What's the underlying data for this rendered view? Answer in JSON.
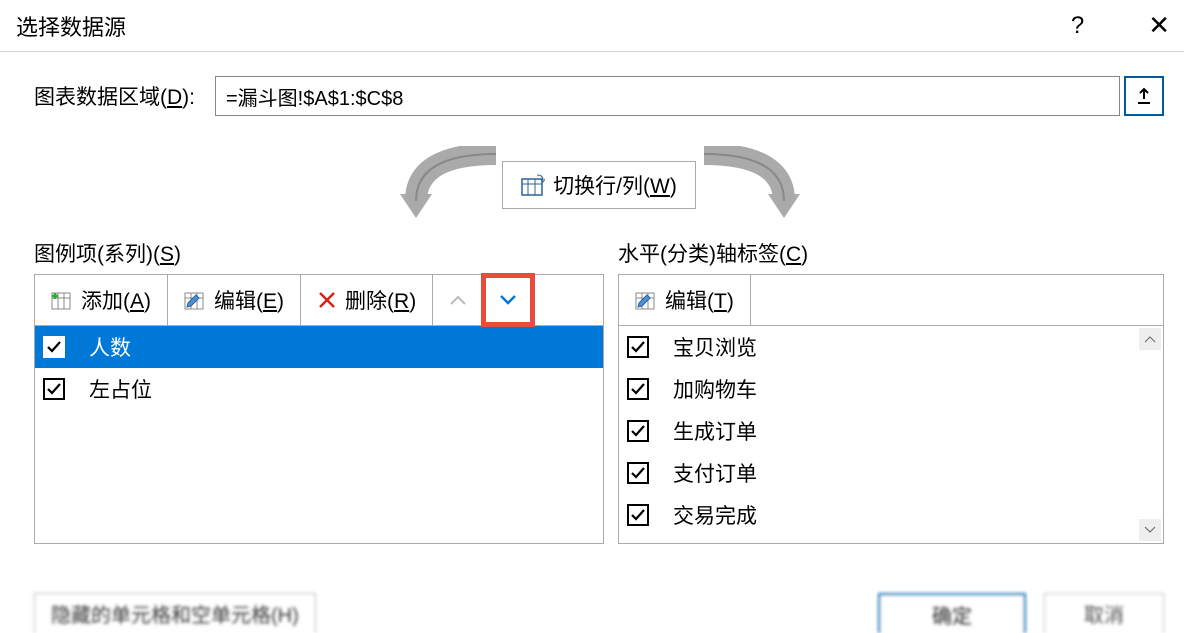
{
  "dialog": {
    "title": "选择数据源",
    "help": "?",
    "close": "✕"
  },
  "range": {
    "label_prefix": "图表数据区域(",
    "label_hotkey": "D",
    "label_suffix": "):",
    "value": "=漏斗图!$A$1:$C$8"
  },
  "switch": {
    "label_prefix": "切换行/列(",
    "label_hotkey": "W",
    "label_suffix": ")"
  },
  "series": {
    "panel_label_prefix": "图例项(系列)(",
    "panel_label_hotkey": "S",
    "panel_label_suffix": ")",
    "add_prefix": "添加(",
    "add_hotkey": "A",
    "add_suffix": ")",
    "edit_prefix": "编辑(",
    "edit_hotkey": "E",
    "edit_suffix": ")",
    "remove_prefix": "删除(",
    "remove_hotkey": "R",
    "remove_suffix": ")",
    "items": [
      {
        "label": "人数",
        "checked": true,
        "selected": true
      },
      {
        "label": "左占位",
        "checked": true,
        "selected": false
      }
    ]
  },
  "categories": {
    "panel_label_prefix": "水平(分类)轴标签(",
    "panel_label_hotkey": "C",
    "panel_label_suffix": ")",
    "edit_prefix": "编辑(",
    "edit_hotkey": "T",
    "edit_suffix": ")",
    "items": [
      {
        "label": "宝贝浏览",
        "checked": true
      },
      {
        "label": "加购物车",
        "checked": true
      },
      {
        "label": "生成订单",
        "checked": true
      },
      {
        "label": "支付订单",
        "checked": true
      },
      {
        "label": "交易完成",
        "checked": true
      }
    ]
  },
  "footer": {
    "hidden_cells": "隐藏的单元格和空单元格(H)",
    "ok": "确定",
    "cancel": "取消"
  }
}
